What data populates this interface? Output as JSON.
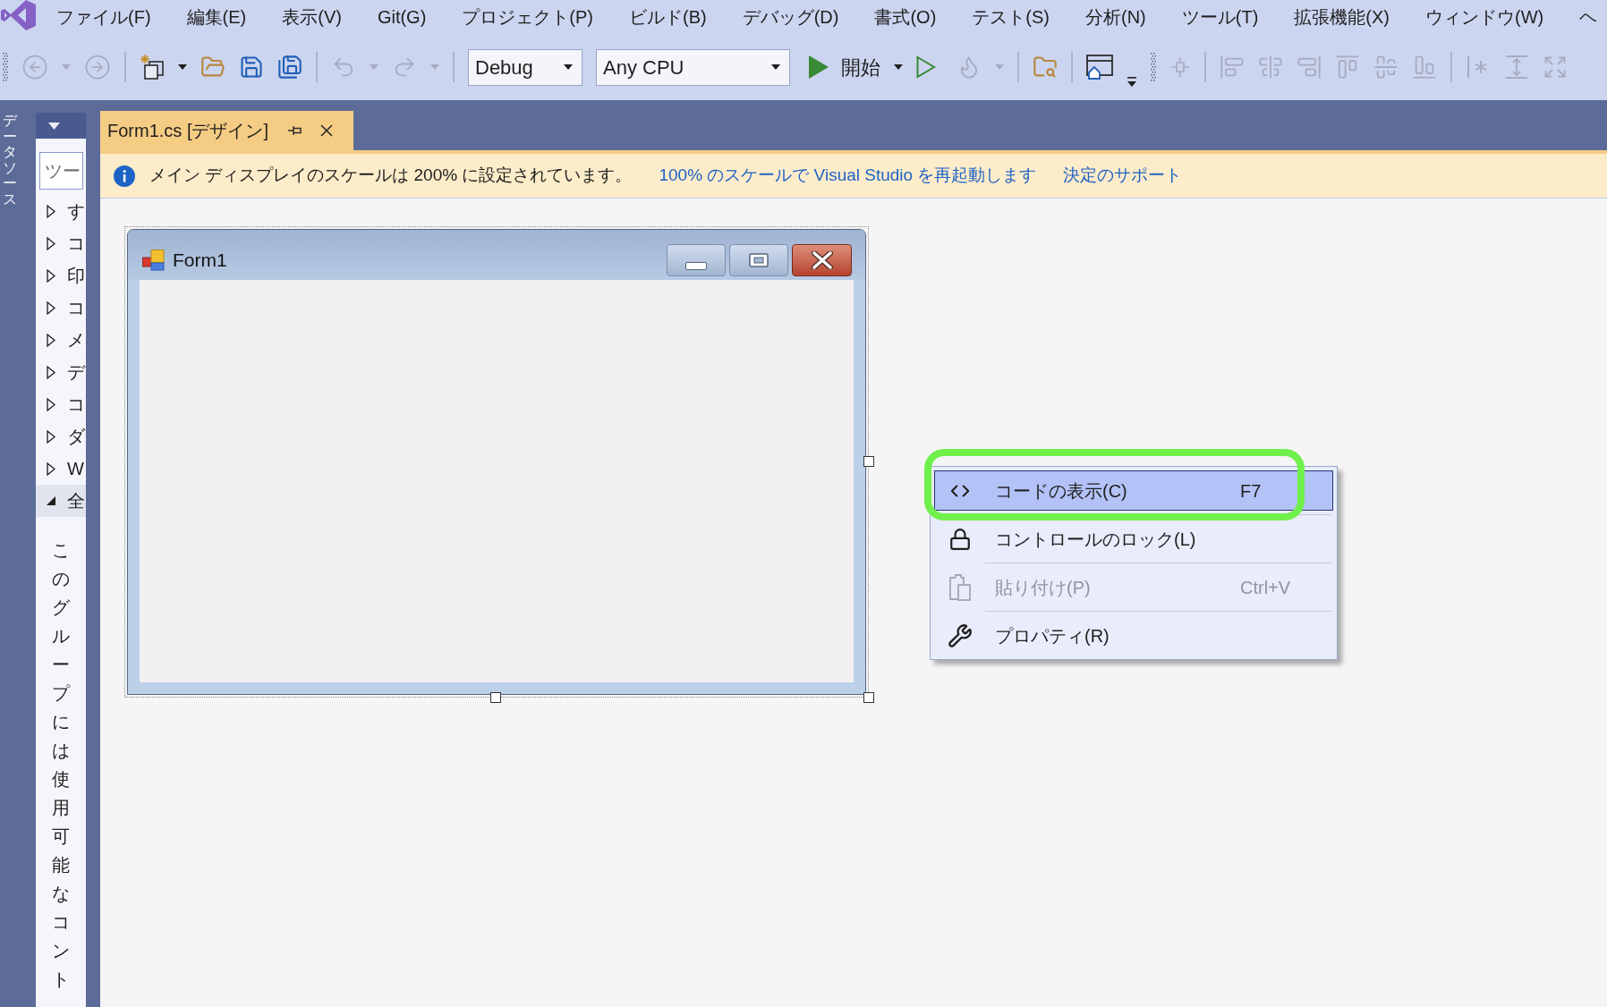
{
  "menu_bar": {
    "items": [
      "ファイル(F)",
      "編集(E)",
      "表示(V)",
      "Git(G)",
      "プロジェクト(P)",
      "ビルド(B)",
      "デバッグ(D)",
      "書式(O)",
      "テスト(S)",
      "分析(N)",
      "ツール(T)",
      "拡張機能(X)",
      "ウィンドウ(W)",
      "ヘ"
    ]
  },
  "toolbar": {
    "items": [
      {
        "kind": "grip"
      },
      {
        "kind": "back",
        "disabled": true
      },
      {
        "kind": "caret",
        "disabled": true
      },
      {
        "kind": "forward",
        "disabled": true
      },
      {
        "kind": "separator"
      },
      {
        "kind": "new-item",
        "disabled": false
      },
      {
        "kind": "caret",
        "disabled": false
      },
      {
        "kind": "open",
        "disabled": false
      },
      {
        "kind": "save",
        "disabled": false
      },
      {
        "kind": "save-all",
        "disabled": false
      },
      {
        "kind": "separator"
      },
      {
        "kind": "undo",
        "disabled": true
      },
      {
        "kind": "caret",
        "disabled": true
      },
      {
        "kind": "redo",
        "disabled": true
      },
      {
        "kind": "caret",
        "disabled": true
      },
      {
        "kind": "separator"
      },
      {
        "kind": "config-combo",
        "value": "Debug"
      },
      {
        "kind": "platform-combo",
        "value": "Any CPU"
      },
      {
        "kind": "start",
        "label": "開始",
        "disabled": false
      },
      {
        "kind": "caret",
        "disabled": false
      },
      {
        "kind": "run",
        "disabled": false
      },
      {
        "kind": "hot-reload",
        "disabled": true
      },
      {
        "kind": "caret",
        "disabled": true
      },
      {
        "kind": "separator"
      },
      {
        "kind": "find-folder",
        "disabled": false
      },
      {
        "kind": "separator"
      },
      {
        "kind": "window",
        "disabled": false
      },
      {
        "kind": "overflow",
        "disabled": false
      },
      {
        "kind": "grip"
      },
      {
        "kind": "grid-align",
        "disabled": true
      },
      {
        "kind": "separator"
      },
      {
        "kind": "align-left",
        "disabled": true
      },
      {
        "kind": "align-center",
        "disabled": true
      },
      {
        "kind": "align-right",
        "disabled": true
      },
      {
        "kind": "align-top",
        "disabled": true
      },
      {
        "kind": "align-middle",
        "disabled": true
      },
      {
        "kind": "align-bottom",
        "disabled": true
      },
      {
        "kind": "separator"
      },
      {
        "kind": "line-asterisk",
        "disabled": true
      },
      {
        "kind": "vertical-spacing",
        "disabled": true
      },
      {
        "kind": "expand",
        "disabled": true
      }
    ]
  },
  "side_tab": {
    "label": "データソース"
  },
  "toolbox": {
    "search": {
      "placeholder": "ツー"
    },
    "groups": [
      {
        "label": "す",
        "expanded": false,
        "selected": false
      },
      {
        "label": "コ",
        "expanded": false,
        "selected": false
      },
      {
        "label": "印",
        "expanded": false,
        "selected": false
      },
      {
        "label": "コ",
        "expanded": false,
        "selected": false
      },
      {
        "label": "メ",
        "expanded": false,
        "selected": false
      },
      {
        "label": "デ",
        "expanded": false,
        "selected": false
      },
      {
        "label": "コ",
        "expanded": false,
        "selected": false
      },
      {
        "label": "ダ",
        "expanded": false,
        "selected": false
      },
      {
        "label": "W",
        "expanded": false,
        "selected": false
      },
      {
        "label": "全",
        "expanded": true,
        "selected": true
      }
    ],
    "empty_message": "このグループには使用可能なコント"
  },
  "tabs": [
    {
      "label": "Form1.cs [デザイン]",
      "selected": true
    }
  ],
  "info_bar": {
    "message": "メイン ディスプレイのスケールは 200% に設定されています。",
    "links": [
      "100% のスケールで Visual Studio を再起動します",
      "決定のサポート"
    ]
  },
  "form": {
    "title": "Form1"
  },
  "context_menu": {
    "items": [
      {
        "kind": "code",
        "label": "コードの表示(C)",
        "shortcut": "F7",
        "selected": true,
        "disabled": false,
        "outlined": true
      },
      {
        "kind": "lock",
        "label": "コントロールのロック(L)",
        "selected": false,
        "disabled": false,
        "outlined": false
      },
      {
        "kind": "paste",
        "label": "貼り付け(P)",
        "shortcut": "Ctrl+V",
        "selected": false,
        "disabled": true,
        "outlined": false
      },
      {
        "kind": "properties",
        "label": "プロパティ(R)",
        "selected": false,
        "disabled": false,
        "outlined": false
      }
    ]
  }
}
